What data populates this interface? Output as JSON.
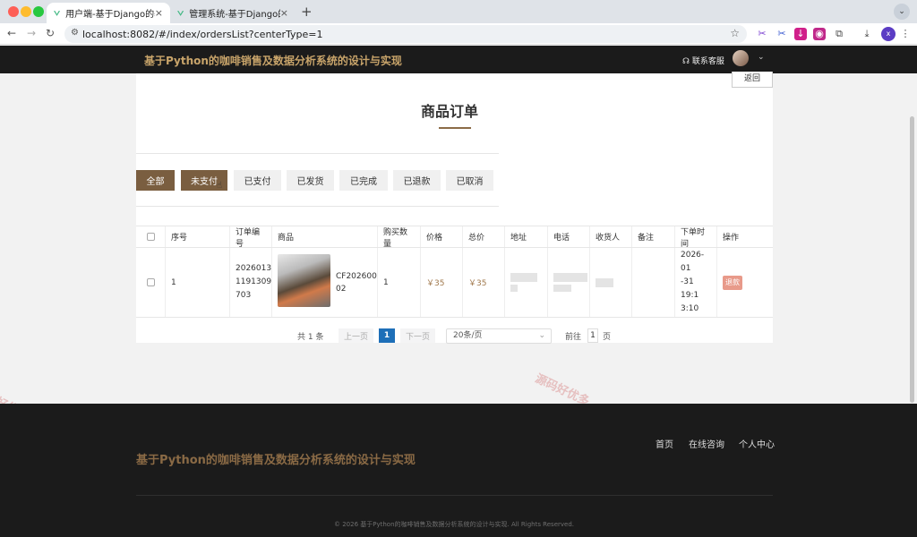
{
  "browser": {
    "tabs": [
      {
        "label": "用户端-基于Django的基于Pyth",
        "active": true
      },
      {
        "label": "管理系统-基于Django的基于Py",
        "active": false
      }
    ],
    "url": "localhost:8082/#/index/ordersList?centerType=1",
    "profile_initial": "x"
  },
  "header": {
    "title": "基于Python的咖啡销售及数据分析系统的设计与实现",
    "service_label": "联系客服"
  },
  "page": {
    "back_label": "返回",
    "title": "商品订单",
    "filters": [
      "全部",
      "未支付",
      "已支付",
      "已发货",
      "已完成",
      "已退款",
      "已取消"
    ]
  },
  "table": {
    "columns": [
      "序号",
      "订单编号",
      "商品",
      "购买数量",
      "价格",
      "总价",
      "地址",
      "电话",
      "收货人",
      "备注",
      "下单时间",
      "操作"
    ],
    "rows": [
      {
        "index": "1",
        "order_no": "20260131191309703",
        "order_no_display": "2026013\n1191309\n703",
        "goods_code": "CF202600\n02",
        "quantity": "1",
        "price": "￥35",
        "total": "￥35",
        "remark": "",
        "time_display": "2026-01\n-31 19:1\n3:10",
        "action": "退款"
      }
    ]
  },
  "pagination": {
    "total_label": "共 1 条",
    "prev_label": "上一页",
    "current": "1",
    "next_label": "下一页",
    "page_size": "20条/页",
    "goto_label": "前往",
    "goto_value": "1",
    "page_unit": "页"
  },
  "footer": {
    "title": "基于Python的咖啡销售及数据分析系统的设计与实现",
    "links": [
      "首页",
      "在线咨询",
      "个人中心"
    ],
    "copyright": "© 2026 基于Python的咖啡销售及数据分析系统的设计与实现. All Rights Reserved."
  },
  "watermark": "源码好优多",
  "colors": {
    "brand": "#7a5e40",
    "header_bg": "#1b1b1b",
    "price": "#a0784c",
    "refund": "#e89a8a",
    "pagination_active": "#1e6fb8"
  }
}
